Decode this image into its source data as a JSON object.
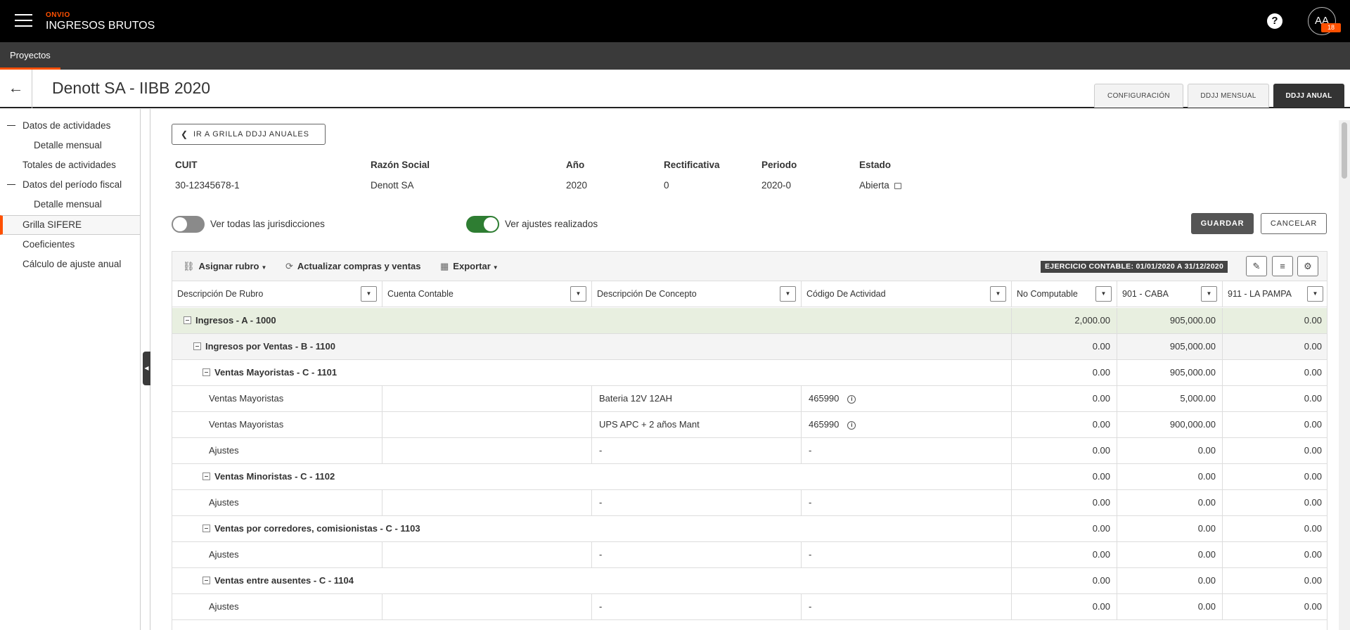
{
  "app": {
    "brand_small": "ONVIO",
    "brand_big": "INGRESOS BRUTOS",
    "help": "?",
    "avatar": "AA",
    "avatar_badge": "18"
  },
  "nav": {
    "projects": "Proyectos"
  },
  "header": {
    "back": "←",
    "title": "Denott SA - IIBB 2020",
    "tabs": [
      {
        "label": "CONFIGURACIÓN"
      },
      {
        "label": "DDJJ MENSUAL"
      },
      {
        "label": "DDJJ ANUAL"
      }
    ]
  },
  "sidebar": {
    "items": [
      {
        "label": "Datos de actividades"
      },
      {
        "label": "Detalle mensual"
      },
      {
        "label": "Totales de actividades"
      },
      {
        "label": "Datos del período fiscal"
      },
      {
        "label": "Detalle mensual"
      },
      {
        "label": "Grilla SIFERE"
      },
      {
        "label": "Coeficientes"
      },
      {
        "label": "Cálculo de ajuste anual"
      }
    ]
  },
  "main": {
    "back_button": "IR A GRILLA DDJJ ANUALES",
    "info": {
      "cuit_label": "CUIT",
      "cuit": "30-12345678-1",
      "razon_label": "Razón Social",
      "razon": "Denott SA",
      "anio_label": "Año",
      "anio": "2020",
      "rect_label": "Rectificativa",
      "rect": "0",
      "periodo_label": "Periodo",
      "periodo": "2020-0",
      "estado_label": "Estado",
      "estado": "Abierta"
    },
    "toggle_jurisdicciones": "Ver todas las jurisdicciones",
    "toggle_ajustes": "Ver ajustes realizados",
    "save": "GUARDAR",
    "cancel": "CANCELAR"
  },
  "grid": {
    "toolbar": {
      "asignar": "Asignar rubro",
      "actualizar": "Actualizar compras y ventas",
      "exportar": "Exportar",
      "ejercicio": "EJERCICIO CONTABLE: 01/01/2020 A 31/12/2020"
    },
    "columns": [
      "Descripción De Rubro",
      "Cuenta Contable",
      "Descripción De Concepto",
      "Código De Actividad",
      "No Computable",
      "901 - CABA",
      "911 - LA PAMPA"
    ],
    "rows": [
      {
        "label": "Ingresos - A - 1000",
        "cuenta": "",
        "concepto": "",
        "codigo": "",
        "nc": "2,000.00",
        "caba": "905,000.00",
        "lp": "0.00"
      },
      {
        "label": "Ingresos por Ventas - B - 1100",
        "cuenta": "",
        "concepto": "",
        "codigo": "",
        "nc": "0.00",
        "caba": "905,000.00",
        "lp": "0.00"
      },
      {
        "label": "Ventas Mayoristas - C - 1101",
        "cuenta": "",
        "concepto": "",
        "codigo": "",
        "nc": "0.00",
        "caba": "905,000.00",
        "lp": "0.00"
      },
      {
        "label": "Ventas Mayoristas",
        "cuenta": "",
        "concepto": "Bateria 12V 12AH",
        "codigo": "465990",
        "nc": "0.00",
        "caba": "5,000.00",
        "lp": "0.00"
      },
      {
        "label": "Ventas Mayoristas",
        "cuenta": "",
        "concepto": "UPS APC + 2 años Mant",
        "codigo": "465990",
        "nc": "0.00",
        "caba": "900,000.00",
        "lp": "0.00"
      },
      {
        "label": "Ajustes",
        "cuenta": "",
        "concepto": "-",
        "codigo": "-",
        "nc": "0.00",
        "caba": "0.00",
        "lp": "0.00"
      },
      {
        "label": "Ventas Minoristas - C - 1102",
        "cuenta": "",
        "concepto": "",
        "codigo": "",
        "nc": "0.00",
        "caba": "0.00",
        "lp": "0.00"
      },
      {
        "label": "Ajustes",
        "cuenta": "",
        "concepto": "-",
        "codigo": "-",
        "nc": "0.00",
        "caba": "0.00",
        "lp": "0.00"
      },
      {
        "label": "Ventas por corredores, comisionistas - C - 1103",
        "cuenta": "",
        "concepto": "",
        "codigo": "",
        "nc": "0.00",
        "caba": "0.00",
        "lp": "0.00"
      },
      {
        "label": "Ajustes",
        "cuenta": "",
        "concepto": "-",
        "codigo": "-",
        "nc": "0.00",
        "caba": "0.00",
        "lp": "0.00"
      },
      {
        "label": "Ventas entre ausentes - C - 1104",
        "cuenta": "",
        "concepto": "",
        "codigo": "",
        "nc": "0.00",
        "caba": "0.00",
        "lp": "0.00"
      },
      {
        "label": "Ajustes",
        "cuenta": "",
        "concepto": "-",
        "codigo": "-",
        "nc": "0.00",
        "caba": "0.00",
        "lp": "0.00"
      }
    ]
  },
  "colors": {
    "accent": "#fe5000",
    "toggle_on": "#2e7d32",
    "toggle_off": "#8a8a8a",
    "row_level1": "#e8efe0",
    "row_level2": "#f4f4f4"
  }
}
